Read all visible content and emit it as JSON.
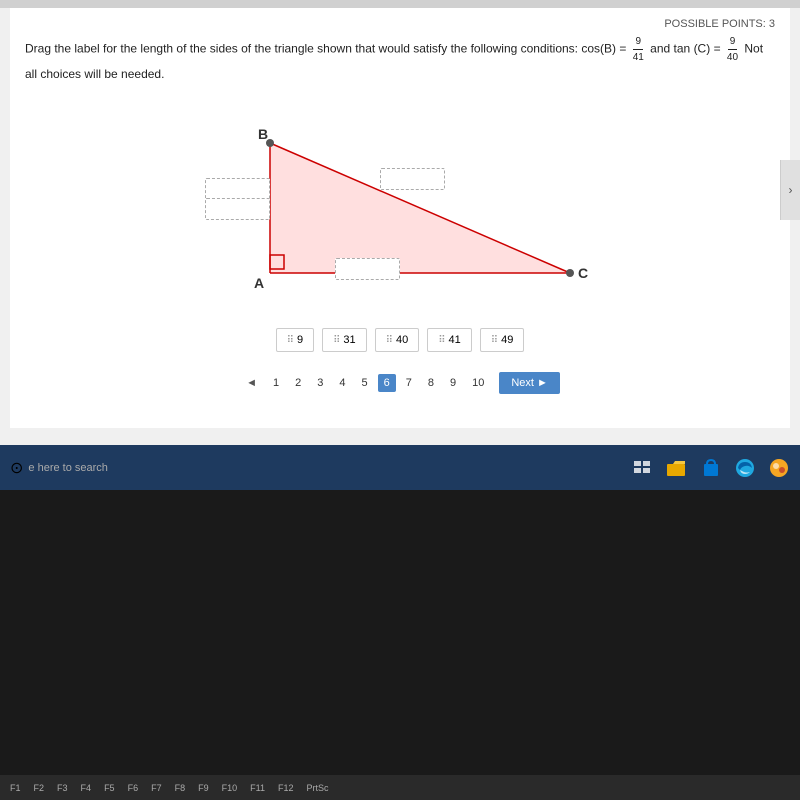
{
  "header": {
    "possible_points": "POSSIBLE POINTS: 3"
  },
  "question": {
    "instruction": "Drag the label for the length of the sides of the triangle shown that would satisfy the following conditions:",
    "condition1_func": "cos(B)",
    "condition1_eq": "=",
    "condition1_num": "9",
    "condition1_den": "41",
    "conjunction": "and",
    "condition2_func": "tan (C)",
    "condition2_eq": "=",
    "condition2_num": "9",
    "condition2_den": "40",
    "note": "Not all choices will be needed."
  },
  "triangle": {
    "vertices": {
      "A": "A",
      "B": "B",
      "C": "C"
    }
  },
  "drag_labels": [
    {
      "id": 1,
      "value": "9"
    },
    {
      "id": 2,
      "value": "31"
    },
    {
      "id": 3,
      "value": "40"
    },
    {
      "id": 4,
      "value": "41"
    },
    {
      "id": 5,
      "value": "49"
    }
  ],
  "pagination": {
    "prev": "◄",
    "next_label": "Next ►",
    "pages": [
      "1",
      "2",
      "3",
      "4",
      "5",
      "6",
      "7",
      "8",
      "9",
      "10"
    ],
    "active_page": "6"
  },
  "taskbar": {
    "search_text": "e here to search"
  }
}
